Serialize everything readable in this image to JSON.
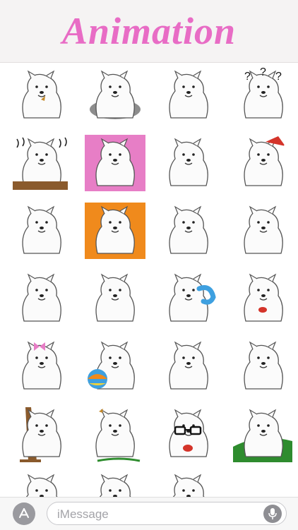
{
  "header": {
    "title": "Animation"
  },
  "stickers": [
    {
      "label": "samoyed-butterfly"
    },
    {
      "label": "samoyed-shadow"
    },
    {
      "label": "samoyed-profile"
    },
    {
      "label": "samoyed-confused"
    },
    {
      "label": "samoyed-angry"
    },
    {
      "label": "samoyed-curtain"
    },
    {
      "label": "samoyed-stretch"
    },
    {
      "label": "samoyed-santa-hat"
    },
    {
      "label": "samoyed-walking"
    },
    {
      "label": "samoyed-sunburst"
    },
    {
      "label": "samoyed-hug"
    },
    {
      "label": "samoyed-chin-rest"
    },
    {
      "label": "samoyed-smile"
    },
    {
      "label": "samoyed-sitting"
    },
    {
      "label": "samoyed-phone"
    },
    {
      "label": "samoyed-tongue"
    },
    {
      "label": "samoyed-bow"
    },
    {
      "label": "samoyed-ball"
    },
    {
      "label": "samoyed-standing"
    },
    {
      "label": "samoyed-crying"
    },
    {
      "label": "samoyed-tree"
    },
    {
      "label": "samoyed-butterfly-nose"
    },
    {
      "label": "samoyed-glasses"
    },
    {
      "label": "samoyed-grass"
    },
    {
      "label": "samoyed-peek-1"
    },
    {
      "label": "samoyed-peek-2"
    },
    {
      "label": "samoyed-peek-3"
    }
  ],
  "input_bar": {
    "placeholder": "iMessage",
    "app_icon": "app-store-icon",
    "mic_icon": "microphone-icon"
  },
  "colors": {
    "title": "#e86cc5",
    "header_bg": "#f5f3f3",
    "pink": "#e77ec6",
    "orange": "#f08a1c",
    "blue": "#3ea0e0",
    "green": "#2e8c2e",
    "brown": "#8a5a2c",
    "red": "#d4342a"
  }
}
